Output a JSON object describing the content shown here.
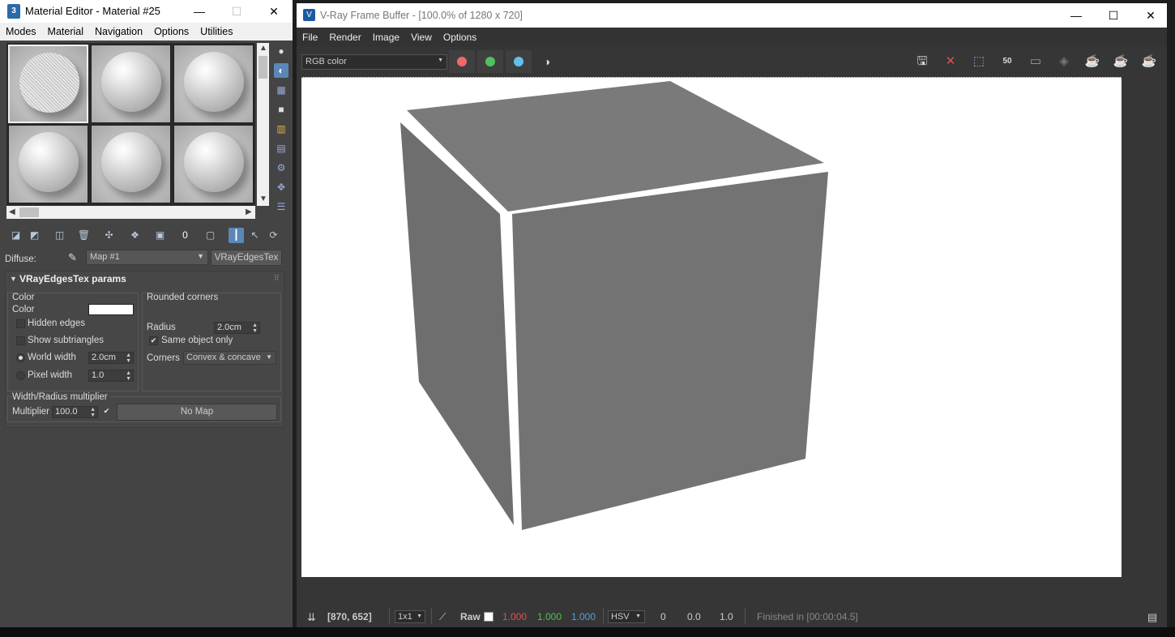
{
  "material_editor": {
    "title": "Material Editor - Material #25",
    "app_icon": "3",
    "menu": [
      "Modes",
      "Material",
      "Navigation",
      "Options",
      "Utilities"
    ],
    "diffuse_label": "Diffuse:",
    "map_dropdown": "Map #1",
    "map_type_button": "VRayEdgesTex",
    "rollout_title": "VRayEdgesTex params",
    "color_group": {
      "title": "Color",
      "color_label": "Color",
      "color_swatch": "#ffffff",
      "hidden_edges": "Hidden edges",
      "show_subtriangles": "Show subtriangles",
      "world_width_label": "World width",
      "world_width_value": "2.0cm",
      "pixel_width_label": "Pixel width",
      "pixel_width_value": "1.0"
    },
    "rounded_group": {
      "title": "Rounded corners",
      "radius_label": "Radius",
      "radius_value": "2.0cm",
      "same_object_label": "Same object only",
      "corners_label": "Corners",
      "corners_value": "Convex & concave"
    },
    "multiplier_group": {
      "title": "Width/Radius multiplier",
      "multiplier_label": "Multiplier",
      "multiplier_value": "100.0",
      "no_map": "No Map"
    }
  },
  "vfb": {
    "title": "V-Ray Frame Buffer - [100.0% of 1280 x 720]",
    "app_icon": "V",
    "menu": [
      "File",
      "Render",
      "Image",
      "View",
      "Options"
    ],
    "channel": "RGB color",
    "zoom_icon_text": "50",
    "channel_colors": {
      "red": "#f06060",
      "green": "#50c060",
      "blue": "#60c0f0"
    },
    "status": {
      "coords": "[870, 652]",
      "sample": "1x1",
      "raw": "Raw",
      "r": "1.000",
      "g": "1.000",
      "b": "1.000",
      "mode": "HSV",
      "h": "0",
      "s": "0.0",
      "v": "1.0",
      "finished": "Finished in [00:00:04.5]"
    }
  },
  "window_buttons": {
    "minimize": "—",
    "maximize": "☐",
    "close": "✕"
  }
}
